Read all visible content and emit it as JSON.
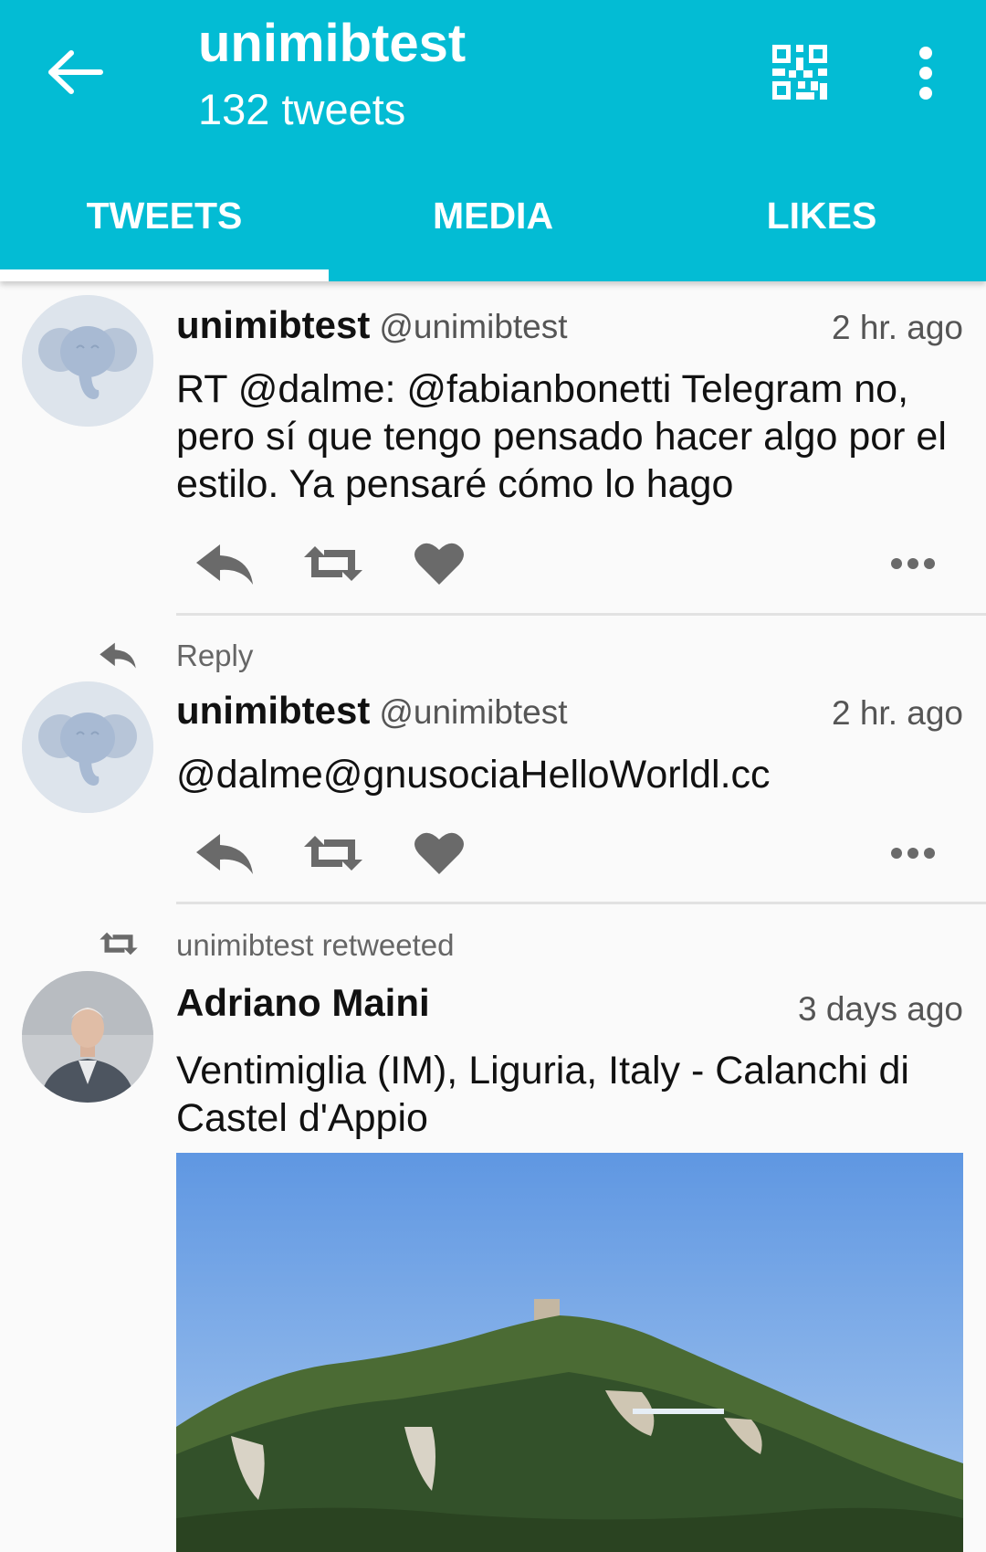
{
  "header": {
    "title": "unimibtest",
    "subtitle": "132 tweets",
    "back_icon": "arrow-left-icon",
    "qr_icon": "qr-code-icon",
    "more_icon": "more-vert-icon",
    "background_color": "#03bcd4"
  },
  "tabs": [
    {
      "label": "TWEETS",
      "selected": true
    },
    {
      "label": "MEDIA",
      "selected": false
    },
    {
      "label": "LIKES",
      "selected": false
    }
  ],
  "timeline": [
    {
      "name": "unimibtest",
      "handle": "@unimibtest",
      "time": "2 hr. ago",
      "text": "RT @dalme: @fabianbonetti Telegram no, pero sí que tengo pensado hacer algo por el estilo. Ya pensaré cómo lo hago",
      "avatar": "elephant-avatar"
    },
    {
      "context": "Reply",
      "context_icon": "reply-icon",
      "name": "unimibtest",
      "handle": "@unimibtest",
      "time": "2 hr. ago",
      "text": "@dalme@gnusociaHelloWorldl.cc",
      "avatar": "elephant-avatar"
    },
    {
      "context": "unimibtest retweeted",
      "context_icon": "retweet-icon",
      "name": "Adriano Maini",
      "handle": "",
      "time": "3 days ago",
      "text": "Ventimiglia (IM), Liguria, Italy - Calanchi di Castel d'Appio",
      "avatar": "person-photo-avatar",
      "media": "landscape-photo"
    }
  ],
  "action_icons": [
    "reply-icon",
    "retweet-icon",
    "heart-icon",
    "more-horiz-icon"
  ]
}
